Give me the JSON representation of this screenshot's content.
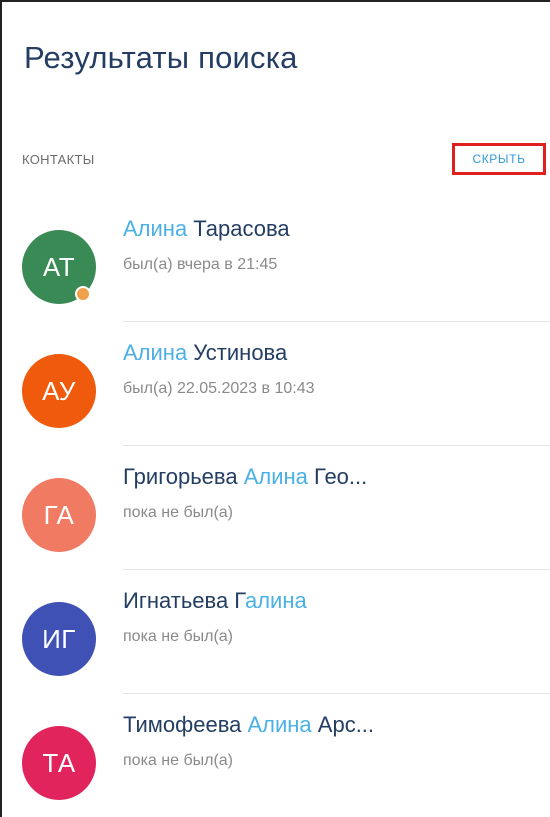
{
  "header": {
    "title": "Результаты поиска"
  },
  "contacts_section": {
    "label": "КОНТАКТЫ",
    "hide_label": "СКРЫТЬ"
  },
  "contacts": [
    {
      "initials": "АТ",
      "avatar_color": "#3a8a55",
      "has_status_dot": true,
      "name_parts": [
        {
          "text": "Алина",
          "highlight": true
        },
        {
          "text": " Тарасова",
          "highlight": false
        }
      ],
      "status": "был(а) вчера в 21:45"
    },
    {
      "initials": "АУ",
      "avatar_color": "#f05a0c",
      "has_status_dot": false,
      "name_parts": [
        {
          "text": "Алина",
          "highlight": true
        },
        {
          "text": " Устинова",
          "highlight": false
        }
      ],
      "status": "был(а) 22.05.2023 в 10:43"
    },
    {
      "initials": "ГА",
      "avatar_color": "#f07b62",
      "has_status_dot": false,
      "name_parts": [
        {
          "text": "Григорьева ",
          "highlight": false
        },
        {
          "text": "Алина",
          "highlight": true
        },
        {
          "text": " Гео...",
          "highlight": false
        }
      ],
      "status": "пока не был(а)"
    },
    {
      "initials": "ИГ",
      "avatar_color": "#3f51b5",
      "has_status_dot": false,
      "name_parts": [
        {
          "text": "Игнатьева Г",
          "highlight": false
        },
        {
          "text": "алина",
          "highlight": true
        }
      ],
      "status": "пока не был(а)"
    },
    {
      "initials": "ТА",
      "avatar_color": "#e2245d",
      "has_status_dot": false,
      "name_parts": [
        {
          "text": "Тимофеева ",
          "highlight": false
        },
        {
          "text": "Алина",
          "highlight": true
        },
        {
          "text": " Арс...",
          "highlight": false
        }
      ],
      "status": "пока не был(а)"
    }
  ]
}
